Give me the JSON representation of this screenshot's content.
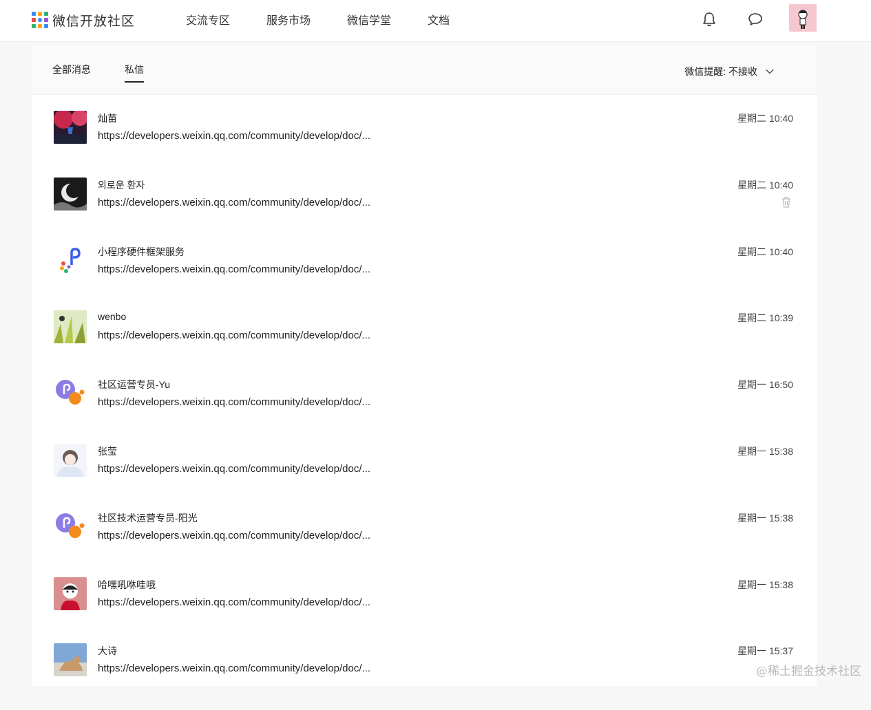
{
  "header": {
    "logo_text": "微信开放社区",
    "nav": [
      "交流专区",
      "服务市场",
      "微信学堂",
      "文档"
    ],
    "icons": [
      "bell-icon",
      "chat-bubble-icon"
    ]
  },
  "tabs": [
    {
      "label": "全部消息",
      "active": false
    },
    {
      "label": "私信",
      "active": true
    }
  ],
  "reminder": {
    "label": "微信提醒: 不接收"
  },
  "messages": [
    {
      "name": "灿苗",
      "text": "https://developers.weixin.qq.com/community/develop/doc/...",
      "time": "星期二 10:40"
    },
    {
      "name": "외로운 환자",
      "text": "https://developers.weixin.qq.com/community/develop/doc/...",
      "time": "星期二 10:40",
      "show_delete": true
    },
    {
      "name": "小程序硬件框架服务",
      "text": "https://developers.weixin.qq.com/community/develop/doc/...",
      "time": "星期二 10:40"
    },
    {
      "name": "wenbo",
      "text": "https://developers.weixin.qq.com/community/develop/doc/...",
      "time": "星期二 10:39"
    },
    {
      "name": "社区运营专员-Yu",
      "text": "https://developers.weixin.qq.com/community/develop/doc/...",
      "time": "星期一 16:50"
    },
    {
      "name": "张莹",
      "text": "https://developers.weixin.qq.com/community/develop/doc/...",
      "time": "星期一 15:38"
    },
    {
      "name": "社区技术运营专员-阳光",
      "text": "https://developers.weixin.qq.com/community/develop/doc/...",
      "time": "星期一 15:38"
    },
    {
      "name": "哈嘿吼咻哇哦",
      "text": "https://developers.weixin.qq.com/community/develop/doc/...",
      "time": "星期一 15:38"
    },
    {
      "name": "大诗",
      "text": "https://developers.weixin.qq.com/community/develop/doc/...",
      "time": "星期一 15:37"
    }
  ],
  "watermark": "@稀土掘金技术社区"
}
